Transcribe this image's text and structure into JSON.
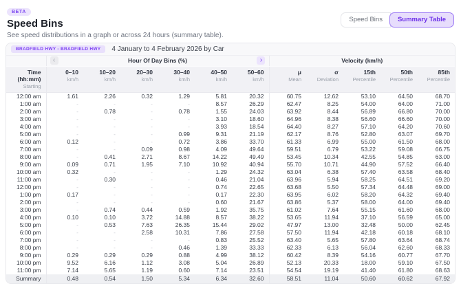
{
  "header": {
    "beta_label": "BETA",
    "title": "Speed Bins",
    "subtitle": "See speed distributions in a graph or across 24 hours (summary table).",
    "tabs": [
      {
        "label": "Speed Bins",
        "selected": false
      },
      {
        "label": "Summary Table",
        "selected": true
      }
    ]
  },
  "filter": {
    "route": "BRADFIELD HWY - BRADFIELD HWY",
    "period": "4 January to 4 February 2026 by Car"
  },
  "colors": {
    "accent_purple": "#7b3ff2",
    "accent_purple_bg": "#ece4fd",
    "header_bg": "#f1f1f5",
    "summary_row_bg": "#eff0f3"
  },
  "table": {
    "groups": {
      "bins": "Hour Of Day Bins (%)",
      "velocity": "Velocity (km/h)"
    },
    "pager": {
      "left_icon": "‹",
      "right_icon": "›"
    },
    "time_column": {
      "label": "Time (hh:mm)",
      "sublabel": "Starting"
    },
    "bin_columns": [
      {
        "label": "0–10",
        "sublabel": "km/h"
      },
      {
        "label": "10–20",
        "sublabel": "km/h"
      },
      {
        "label": "20–30",
        "sublabel": "km/h"
      },
      {
        "label": "30–40",
        "sublabel": "km/h"
      },
      {
        "label": "40–50",
        "sublabel": "km/h"
      },
      {
        "label": "50–60",
        "sublabel": "km/h"
      }
    ],
    "velocity_columns": [
      {
        "label": "μ",
        "sublabel": "Mean"
      },
      {
        "label": "σ",
        "sublabel": "Deviation"
      },
      {
        "label": "15th",
        "sublabel": "Percentile"
      },
      {
        "label": "50th",
        "sublabel": "Percentile"
      },
      {
        "label": "85th",
        "sublabel": "Percentile"
      }
    ],
    "rows": [
      {
        "time": "12:00 am",
        "bins": [
          "1.61",
          "2.26",
          "0.32",
          "1.29",
          "5.81",
          "20.32"
        ],
        "velocity": [
          "60.75",
          "12.62",
          "53.10",
          "64.50",
          "68.70"
        ]
      },
      {
        "time": "1:00 am",
        "bins": [
          "-",
          "-",
          "-",
          "-",
          "8.57",
          "26.29"
        ],
        "velocity": [
          "62.47",
          "8.25",
          "54.00",
          "64.00",
          "71.00"
        ]
      },
      {
        "time": "2:00 am",
        "bins": [
          "-",
          "0.78",
          "-",
          "0.78",
          "1.55",
          "24.03"
        ],
        "velocity": [
          "63.92",
          "8.44",
          "56.89",
          "66.80",
          "70.00"
        ]
      },
      {
        "time": "3:00 am",
        "bins": [
          "-",
          "-",
          "-",
          "-",
          "3.10",
          "18.60"
        ],
        "velocity": [
          "64.96",
          "8.38",
          "56.60",
          "66.60",
          "70.00"
        ]
      },
      {
        "time": "4:00 am",
        "bins": [
          "-",
          "-",
          "-",
          "-",
          "3.93",
          "18.54"
        ],
        "velocity": [
          "64.40",
          "8.27",
          "57.10",
          "64.20",
          "70.60"
        ]
      },
      {
        "time": "5:00 am",
        "bins": [
          "-",
          "-",
          "-",
          "0.99",
          "9.31",
          "21.19"
        ],
        "velocity": [
          "62.17",
          "8.76",
          "52.80",
          "63.07",
          "69.70"
        ]
      },
      {
        "time": "6:00 am",
        "bins": [
          "0.12",
          "-",
          "-",
          "0.72",
          "3.86",
          "33.70"
        ],
        "velocity": [
          "61.33",
          "6.99",
          "55.00",
          "61.50",
          "68.00"
        ]
      },
      {
        "time": "7:00 am",
        "bins": [
          "-",
          "-",
          "0.09",
          "0.98",
          "4.09",
          "49.64"
        ],
        "velocity": [
          "59.51",
          "6.79",
          "53.22",
          "59.08",
          "66.75"
        ]
      },
      {
        "time": "8:00 am",
        "bins": [
          "-",
          "0.41",
          "2.71",
          "8.67",
          "14.22",
          "49.49"
        ],
        "velocity": [
          "53.45",
          "10.34",
          "42.55",
          "54.85",
          "63.00"
        ]
      },
      {
        "time": "9:00 am",
        "bins": [
          "0.09",
          "0.71",
          "1.95",
          "7.10",
          "10.92",
          "40.94"
        ],
        "velocity": [
          "55.70",
          "10.71",
          "44.90",
          "57.52",
          "66.40"
        ]
      },
      {
        "time": "10:00 am",
        "bins": [
          "0.32",
          "-",
          "-",
          "-",
          "1.29",
          "24.32"
        ],
        "velocity": [
          "63.04",
          "6.38",
          "57.40",
          "63.58",
          "68.40"
        ]
      },
      {
        "time": "11:00 am",
        "bins": [
          "-",
          "0.30",
          "-",
          "-",
          "0.46",
          "21.04"
        ],
        "velocity": [
          "63.96",
          "5.94",
          "58.25",
          "64.51",
          "69.20"
        ]
      },
      {
        "time": "12:00 pm",
        "bins": [
          "-",
          "-",
          "-",
          "-",
          "0.74",
          "22.65"
        ],
        "velocity": [
          "63.68",
          "5.50",
          "57.34",
          "64.48",
          "69.00"
        ]
      },
      {
        "time": "1:00 pm",
        "bins": [
          "0.17",
          "-",
          "-",
          "-",
          "0.17",
          "22.30"
        ],
        "velocity": [
          "63.95",
          "6.02",
          "58.20",
          "64.32",
          "69.40"
        ]
      },
      {
        "time": "2:00 pm",
        "bins": [
          "-",
          "-",
          "-",
          "-",
          "0.60",
          "21.67"
        ],
        "velocity": [
          "63.86",
          "5.37",
          "58.00",
          "64.00",
          "69.40"
        ]
      },
      {
        "time": "3:00 pm",
        "bins": [
          "-",
          "0.74",
          "0.44",
          "0.59",
          "1.92",
          "35.75"
        ],
        "velocity": [
          "61.02",
          "7.64",
          "55.15",
          "61.60",
          "68.00"
        ]
      },
      {
        "time": "4:00 pm",
        "bins": [
          "0.10",
          "0.10",
          "3.72",
          "14.88",
          "8.57",
          "38.22"
        ],
        "velocity": [
          "53.65",
          "11.94",
          "37.10",
          "56.59",
          "65.00"
        ]
      },
      {
        "time": "5:00 pm",
        "bins": [
          "-",
          "0.53",
          "7.63",
          "26.35",
          "15.44",
          "29.02"
        ],
        "velocity": [
          "47.97",
          "13.00",
          "32.48",
          "50.00",
          "62.45"
        ]
      },
      {
        "time": "6:00 pm",
        "bins": [
          "-",
          "-",
          "2.58",
          "10.31",
          "7.86",
          "27.58"
        ],
        "velocity": [
          "57.50",
          "11.94",
          "42.18",
          "60.18",
          "68.10"
        ]
      },
      {
        "time": "7:00 pm",
        "bins": [
          "-",
          "-",
          "-",
          "-",
          "0.83",
          "25.52"
        ],
        "velocity": [
          "63.40",
          "5.65",
          "57.80",
          "63.64",
          "68.74"
        ]
      },
      {
        "time": "8:00 pm",
        "bins": [
          "-",
          "-",
          "-",
          "0.46",
          "1.39",
          "33.33"
        ],
        "velocity": [
          "62.33",
          "6.13",
          "56.04",
          "62.60",
          "68.33"
        ]
      },
      {
        "time": "9:00 pm",
        "bins": [
          "0.29",
          "0.29",
          "0.29",
          "0.88",
          "4.99",
          "38.12"
        ],
        "velocity": [
          "60.42",
          "8.39",
          "54.16",
          "60.77",
          "67.70"
        ]
      },
      {
        "time": "10:00 pm",
        "bins": [
          "9.52",
          "6.16",
          "1.12",
          "3.08",
          "5.04",
          "26.89"
        ],
        "velocity": [
          "52.13",
          "20.33",
          "18.00",
          "59.10",
          "67.50"
        ]
      },
      {
        "time": "11:00 pm",
        "bins": [
          "7.14",
          "5.65",
          "1.19",
          "0.60",
          "7.14",
          "23.51"
        ],
        "velocity": [
          "54.54",
          "19.19",
          "41.40",
          "61.80",
          "68.63"
        ]
      }
    ],
    "summary_row": {
      "time": "Summary",
      "bins": [
        "0.48",
        "0.54",
        "1.50",
        "5.34",
        "6.34",
        "32.60"
      ],
      "velocity": [
        "58.51",
        "11.04",
        "50.60",
        "60.62",
        "67.92"
      ]
    }
  }
}
